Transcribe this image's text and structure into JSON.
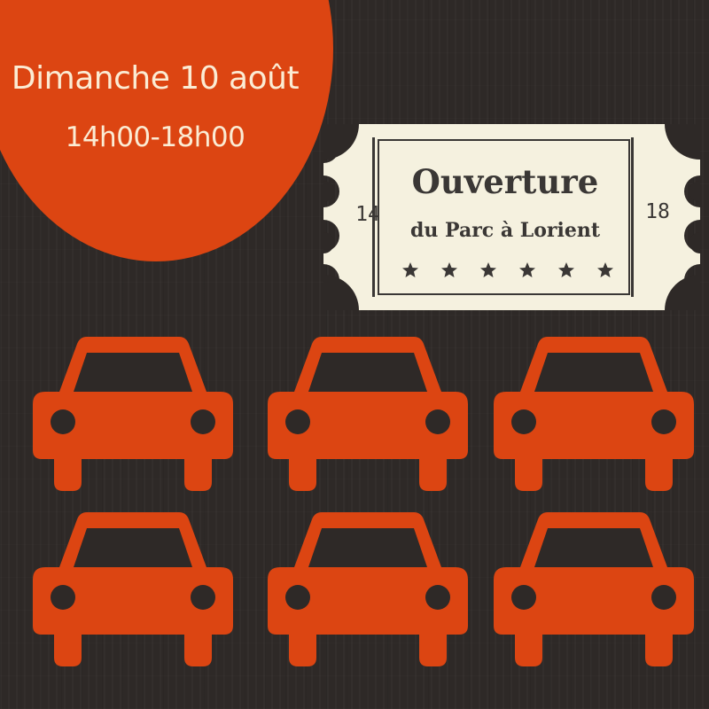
{
  "event": {
    "date": "Dimanche 10 août",
    "time": "14h00-18h00"
  },
  "ticket": {
    "title": "Ouverture",
    "subtitle": "du Parc à Lorient",
    "number_left": "14",
    "number_right": "18",
    "stars": "★ ★ ★ ★ ★ ★"
  },
  "colors": {
    "background": "#2e2927",
    "accent": "#dc4512",
    "ticket": "#f5f1df",
    "ticket_ink": "#3a3735",
    "text_light": "#fbecd4"
  },
  "icons": [
    "car-icon",
    "star-icon",
    "ticket-icon"
  ]
}
